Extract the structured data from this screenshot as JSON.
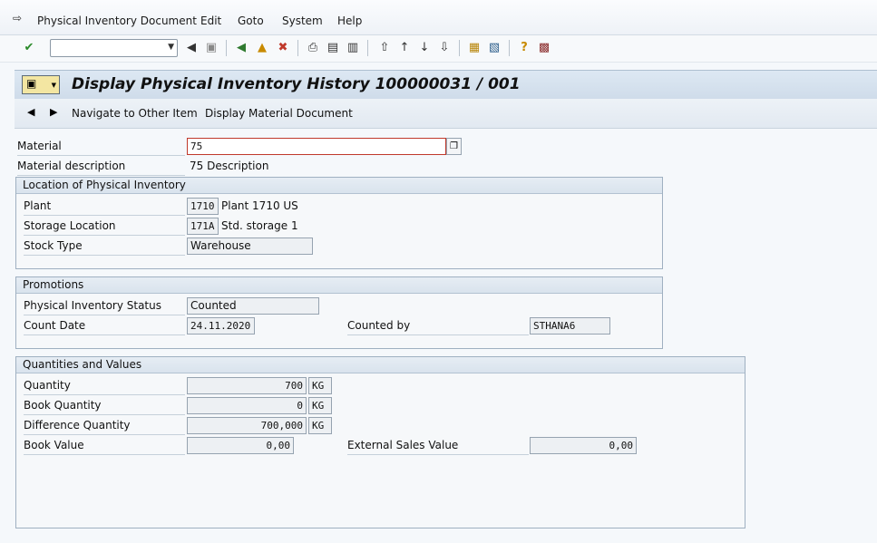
{
  "menu": [
    {
      "label": "Physical Inventory Document"
    },
    {
      "label": "Edit"
    },
    {
      "label": "Goto"
    },
    {
      "label": "System"
    },
    {
      "label": "Help"
    }
  ],
  "title": "Display Physical Inventory History 100000031 / 001",
  "app_toolbar": {
    "navigate_label": "Navigate to Other Item",
    "display_material_doc_label": "Display Material Document"
  },
  "material": {
    "label": "Material",
    "value": "75",
    "desc_label": "Material description",
    "desc_value": "75 Description"
  },
  "location": {
    "header": "Location of Physical Inventory",
    "plant_label": "Plant",
    "plant_code": "1710",
    "plant_name": "Plant 1710 US",
    "storage_label": "Storage Location",
    "storage_code": "171A",
    "storage_name": "Std. storage 1",
    "stock_type_label": "Stock Type",
    "stock_type_value": "Warehouse"
  },
  "promotions": {
    "header": "Promotions",
    "status_label": "Physical Inventory Status",
    "status_value": "Counted",
    "count_date_label": "Count Date",
    "count_date_value": "24.11.2020",
    "counted_by_label": "Counted by",
    "counted_by_value": "STHANA6"
  },
  "quantities": {
    "header": "Quantities and Values",
    "quantity_label": "Quantity",
    "quantity_value": "700",
    "quantity_unit": "KG",
    "book_qty_label": "Book Quantity",
    "book_qty_value": "0",
    "book_qty_unit": "KG",
    "diff_qty_label": "Difference Quantity",
    "diff_qty_value": "700,000",
    "diff_qty_unit": "KG",
    "book_value_label": "Book Value",
    "book_value_value": "0,00",
    "ext_sales_label": "External Sales Value",
    "ext_sales_value": "0,00"
  }
}
